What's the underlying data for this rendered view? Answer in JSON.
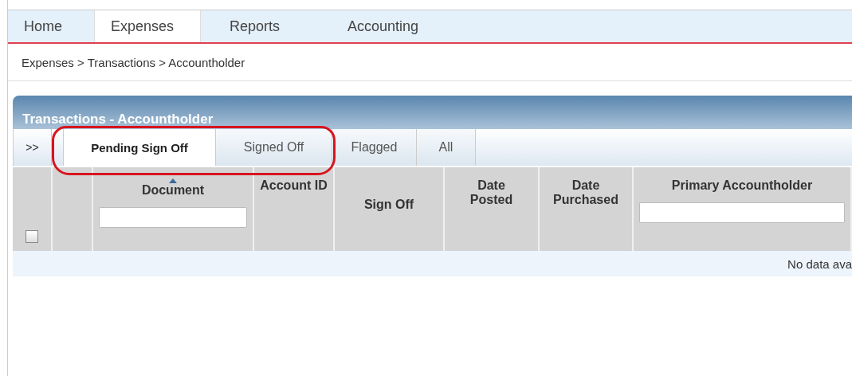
{
  "nav": [
    {
      "label": "Home",
      "selected": false
    },
    {
      "label": "Expenses",
      "selected": true
    },
    {
      "label": "Reports",
      "selected": false
    },
    {
      "label": "Accounting",
      "selected": false
    }
  ],
  "breadcrumb": "Expenses > Transactions > Accountholder",
  "panel": {
    "title": "Transactions - Accountholder"
  },
  "expand_button": ">>",
  "tabs": [
    {
      "label": "Pending Sign Off",
      "selected": true
    },
    {
      "label": "Signed Off",
      "selected": false
    },
    {
      "label": "Flagged",
      "selected": false
    },
    {
      "label": "All",
      "selected": false
    }
  ],
  "table": {
    "select_all": {
      "checked": false
    },
    "columns": [
      {
        "label": "Document",
        "sorted_ascending": true,
        "filter": true
      },
      {
        "label": "Account ID",
        "sorted_ascending": false,
        "filter": false
      },
      {
        "label": "Sign Off",
        "sorted_ascending": false,
        "filter": false
      },
      {
        "label": "Date Posted",
        "sorted_ascending": false,
        "filter": false
      },
      {
        "label": "Date Purchased",
        "sorted_ascending": false,
        "filter": false
      },
      {
        "label": "Primary Accountholder",
        "sorted_ascending": false,
        "filter": true
      }
    ],
    "empty_message": "No data ava"
  }
}
